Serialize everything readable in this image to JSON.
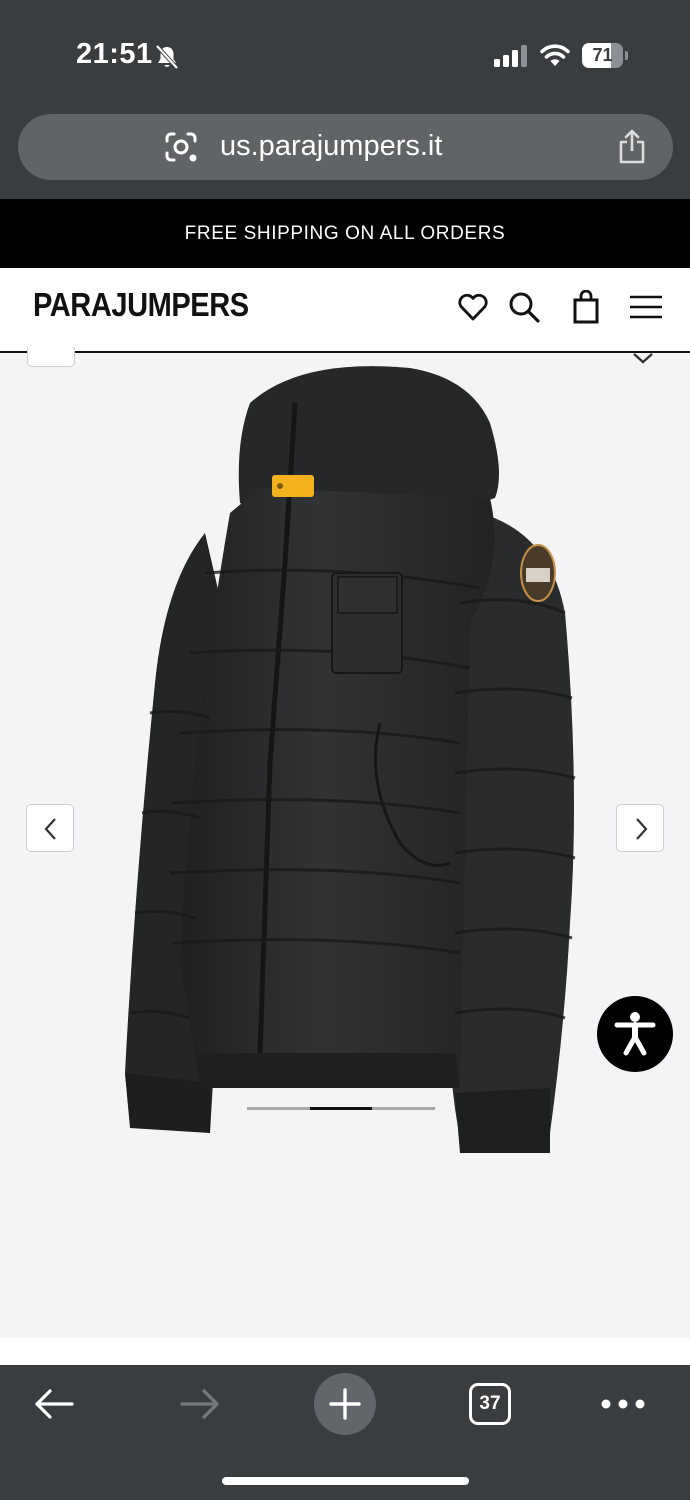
{
  "status_bar": {
    "time": "21:51",
    "battery_level": 71,
    "battery_label": "71",
    "icons": [
      "bell-off-icon",
      "signal-icon",
      "wifi-icon",
      "battery-icon"
    ]
  },
  "browser": {
    "url": "us.parajumpers.it",
    "tab_count": "37",
    "icons": [
      "lens-icon",
      "share-icon",
      "back-arrow-icon",
      "forward-arrow-icon",
      "plus-icon",
      "more-dots-icon"
    ]
  },
  "site": {
    "promo_banner": "FREE SHIPPING ON ALL ORDERS",
    "brand": "PARAJUMPERS",
    "header_icons": [
      "heart-icon",
      "search-icon",
      "bag-icon",
      "menu-icon"
    ]
  },
  "gallery": {
    "current_slide": 2,
    "total_slides": 3,
    "icons": [
      "chevron-left-icon",
      "chevron-right-icon",
      "accessibility-icon"
    ]
  },
  "colors": {
    "browser_chrome": "#3a3d40",
    "url_bar": "#616466",
    "banner_bg": "#000000",
    "page_bg": "#f4f4f6",
    "jacket": "#2b2c2d",
    "tab_yellow": "#f3b21c",
    "tab_orange": "#e8501a"
  }
}
